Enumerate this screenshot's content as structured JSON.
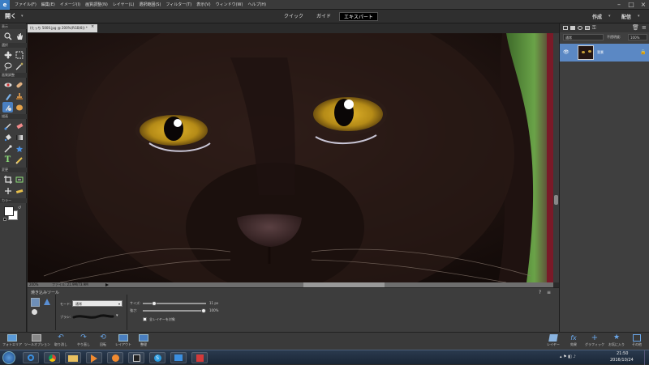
{
  "menubar": {
    "items": [
      "ファイル(F)",
      "編集(E)",
      "イメージ(I)",
      "画質調整(N)",
      "レイヤー(L)",
      "選択範囲(S)",
      "フィルター(T)",
      "表示(V)",
      "ウィンドウ(W)",
      "ヘルプ(H)"
    ]
  },
  "modebar": {
    "open_label": "開く",
    "tabs": [
      {
        "label": "クイック",
        "active": false
      },
      {
        "label": "ガイド",
        "active": false
      },
      {
        "label": "エキスパート",
        "active": true
      }
    ],
    "create_label": "作成",
    "share_label": "配信"
  },
  "toolbox": {
    "sections": [
      "表示",
      "選択",
      "画質調整",
      "描画",
      "変更",
      "カラー"
    ]
  },
  "document": {
    "tab_label": "(たっち 5000.jpg @ 200%(RGB/8)) *",
    "zoom": "200%",
    "file_info": "ファイル: 21.9M/73.9M"
  },
  "options": {
    "tool_name": "焼き込みツール",
    "mode_label": "モード:",
    "mode_value": "通常",
    "brush_label": "ブラシ:",
    "size_label": "サイズ:",
    "size_value": "11 px",
    "strength_label": "強さ:",
    "strength_value": "100%",
    "sample_all_label": "全レイヤーを対象",
    "size_percent": 0.15,
    "strength_percent": 1.0
  },
  "layers": {
    "blend_mode": "通常",
    "opacity_label": "不透明度:",
    "opacity_value": "100%",
    "layer_name": "背景"
  },
  "bottom_panel": {
    "left_buttons": [
      "フォトエリア",
      "ツールオプション",
      "取り消し",
      "やり直し",
      "回転",
      "レイアウト",
      "整理"
    ],
    "right_buttons": [
      "レイヤー",
      "効果",
      "グラフィック",
      "お気に入り",
      "その他"
    ]
  },
  "taskbar": {
    "time": "21:50",
    "date": "2016/10/24"
  }
}
